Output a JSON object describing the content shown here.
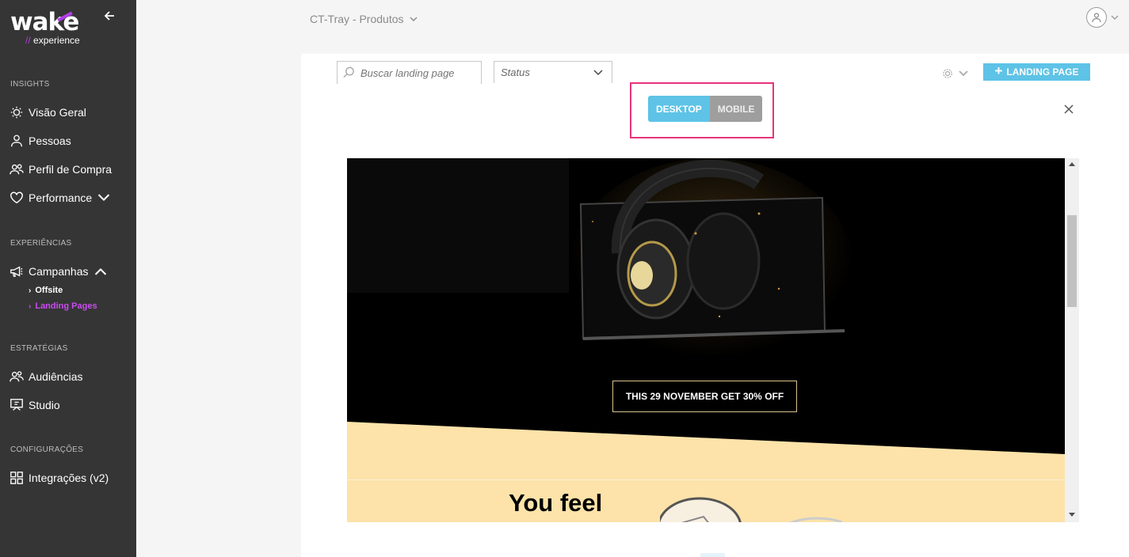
{
  "brand": {
    "logo_text": "wake",
    "logo_sub_prefix": "//",
    "logo_sub": "experience",
    "accent": "#b13ee6"
  },
  "sidebar": {
    "sections": [
      {
        "title": "INSIGHTS"
      },
      {
        "title": "EXPERIÊNCIAS"
      },
      {
        "title": "ESTRATÉGIAS"
      },
      {
        "title": "CONFIGURAÇÕES"
      }
    ],
    "items": [
      {
        "label": "Visão Geral",
        "icon": "lightbulb-icon"
      },
      {
        "label": "Pessoas",
        "icon": "person-icon"
      },
      {
        "label": "Perfil de Compra",
        "icon": "people-icon"
      },
      {
        "label": "Performance",
        "icon": "heart-icon"
      },
      {
        "label": "Campanhas",
        "icon": "megaphone-icon"
      },
      {
        "label": "Audiências",
        "icon": "audience-icon"
      },
      {
        "label": "Studio",
        "icon": "studio-icon"
      },
      {
        "label": "Integrações (v2)",
        "icon": "grid-icon"
      }
    ],
    "sub_items": [
      {
        "label": "Offsite",
        "active": false
      },
      {
        "label": "Landing Pages",
        "active": true,
        "color": "#c94bf0"
      }
    ]
  },
  "header": {
    "project": "CT-Tray - Produtos"
  },
  "filters": {
    "search_placeholder": "Buscar landing page",
    "status_label": "Status"
  },
  "toolbar": {
    "add_label": "LANDING PAGE"
  },
  "preview_toggle": {
    "desktop_label": "DESKTOP",
    "mobile_label": "MOBILE",
    "selected": "DESKTOP"
  },
  "preview": {
    "offer_text": "THIS 29 NOVEMBER GET 30% OFF",
    "headline": "You feel"
  },
  "colors": {
    "sidebar_bg": "#353535",
    "primary": "#5ec3e6",
    "highlight": "#e8337a"
  }
}
